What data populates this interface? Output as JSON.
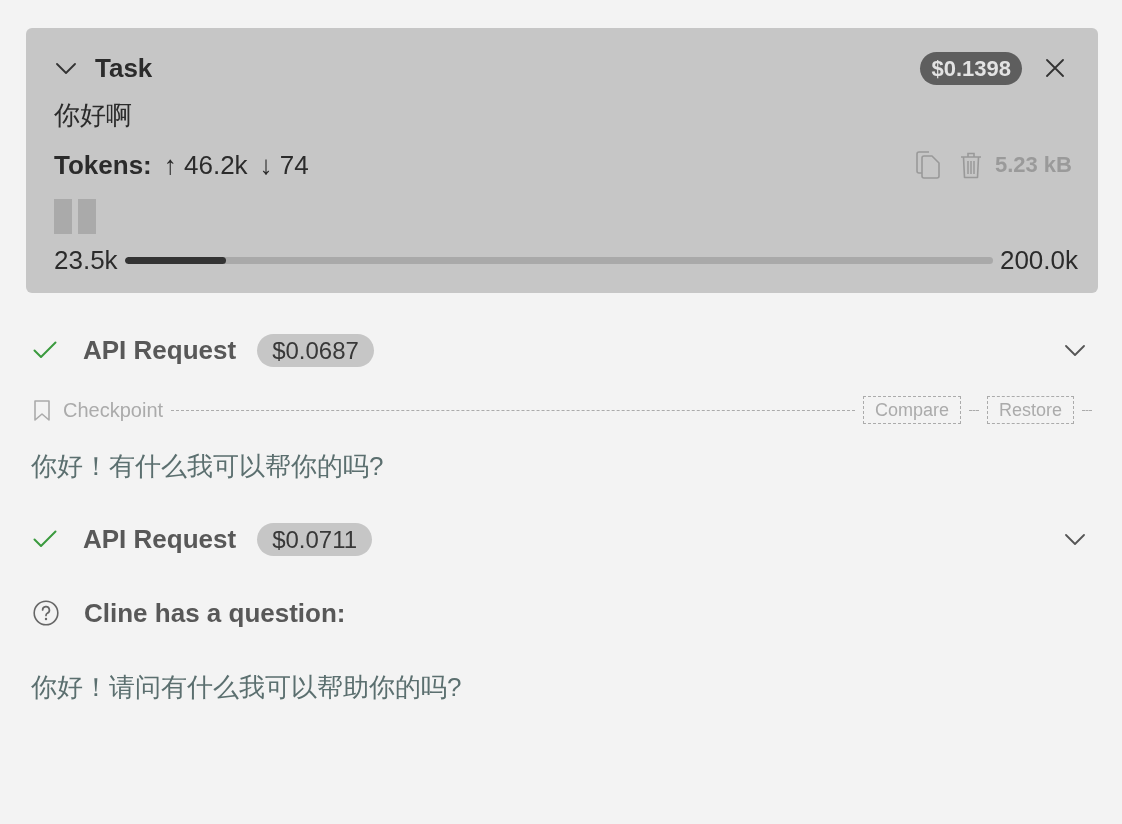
{
  "task": {
    "title": "Task",
    "expanded": true,
    "cost": "$0.1398",
    "text": "你好啊",
    "tokens": {
      "label": "Tokens:",
      "sent": "↑ 46.2k",
      "received": "↓ 74"
    },
    "size": "5.23 kB",
    "context": {
      "used": "23.5k",
      "limit": "200.0k",
      "level": 0.117
    }
  },
  "messages": [
    {
      "kind": "api_request",
      "completed": true,
      "title": "API Request",
      "cost": "$0.0687",
      "expanded": false
    },
    {
      "kind": "checkpoint",
      "label": "Checkpoint",
      "actions": [
        "Compare",
        "Restore"
      ]
    },
    {
      "kind": "text",
      "text": "你好！有什么我可以帮你的吗?"
    },
    {
      "kind": "api_request",
      "completed": true,
      "title": "API Request",
      "cost": "$0.0711",
      "expanded": false
    },
    {
      "kind": "question",
      "title": "Cline has a question:",
      "text": "你好！请问有什么我可以帮助你的吗?"
    }
  ]
}
